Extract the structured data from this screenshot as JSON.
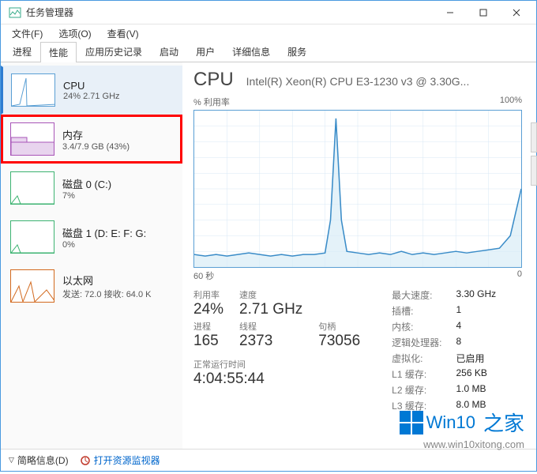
{
  "window": {
    "title": "任务管理器"
  },
  "menu": {
    "file": "文件(F)",
    "options": "选项(O)",
    "view": "查看(V)"
  },
  "tabs": {
    "processes": "进程",
    "performance": "性能",
    "app_history": "应用历史记录",
    "startup": "启动",
    "users": "用户",
    "details": "详细信息",
    "services": "服务"
  },
  "sidebar": [
    {
      "name": "CPU",
      "detail": "24% 2.71 GHz",
      "kind": "cpu",
      "selected": true
    },
    {
      "name": "内存",
      "detail": "3.4/7.9 GB (43%)",
      "kind": "mem",
      "highlighted": true
    },
    {
      "name": "磁盘 0 (C:)",
      "detail": "7%",
      "kind": "disk"
    },
    {
      "name": "磁盘 1 (D: E: F: G:",
      "detail": "0%",
      "kind": "disk"
    },
    {
      "name": "以太网",
      "detail": "发送: 72.0 接收: 64.0 K",
      "kind": "net"
    }
  ],
  "main": {
    "title": "CPU",
    "subtitle": "Intel(R) Xeon(R) CPU E3-1230 v3 @ 3.30G...",
    "y_label": "% 利用率",
    "y_max": "100%",
    "x_left": "60 秒",
    "x_right": "0",
    "left_stats": [
      {
        "label": "利用率",
        "val": "24%"
      },
      {
        "label": "速度",
        "val": "2.71 GHz"
      },
      {
        "label": "",
        "val": ""
      },
      {
        "label": "进程",
        "val": "165"
      },
      {
        "label": "线程",
        "val": "2373"
      },
      {
        "label": "句柄",
        "val": "73056"
      }
    ],
    "uptime_label": "正常运行时间",
    "uptime_val": "4:04:55:44",
    "right_stats": [
      {
        "label": "最大速度:",
        "val": "3.30 GHz"
      },
      {
        "label": "插槽:",
        "val": "1"
      },
      {
        "label": "内核:",
        "val": "4"
      },
      {
        "label": "逻辑处理器:",
        "val": "8"
      },
      {
        "label": "虚拟化:",
        "val": "已启用"
      },
      {
        "label": "L1 缓存:",
        "val": "256 KB"
      },
      {
        "label": "L2 缓存:",
        "val": "1.0 MB"
      },
      {
        "label": "L3 缓存:",
        "val": "8.0 MB"
      }
    ]
  },
  "statusbar": {
    "fewer": "简略信息(D)",
    "resmon": "打开资源监视器"
  },
  "watermark": {
    "brand": "Win10",
    "suffix": "之家",
    "url": "www.win10xitong.com"
  },
  "chart_data": {
    "type": "line",
    "title": "% 利用率",
    "xlabel": "60 秒",
    "ylabel": "% 利用率",
    "xlim": [
      60,
      0
    ],
    "ylim": [
      0,
      100
    ],
    "series": [
      {
        "name": "CPU",
        "x": [
          60,
          58,
          56,
          54,
          52,
          50,
          48,
          46,
          44,
          42,
          40,
          38,
          36,
          35,
          34,
          33,
          32,
          30,
          28,
          26,
          24,
          22,
          20,
          18,
          16,
          14,
          12,
          10,
          8,
          6,
          4,
          2,
          1,
          0
        ],
        "values": [
          8,
          7,
          8,
          7,
          8,
          9,
          8,
          7,
          8,
          7,
          8,
          8,
          9,
          30,
          95,
          30,
          10,
          9,
          8,
          9,
          8,
          10,
          8,
          9,
          8,
          9,
          10,
          9,
          10,
          11,
          12,
          20,
          35,
          50
        ]
      }
    ]
  }
}
